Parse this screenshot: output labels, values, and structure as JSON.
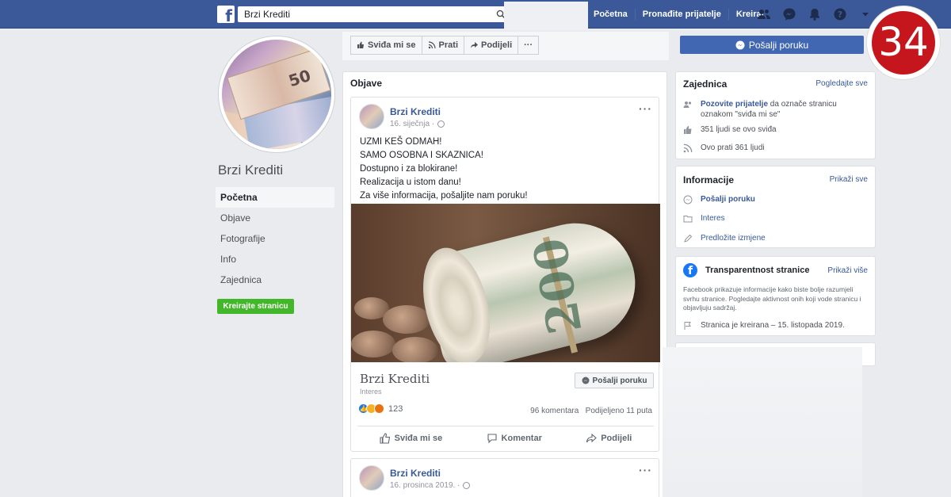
{
  "topbar": {
    "search_value": "Brzi Krediti",
    "nav": [
      "Početna",
      "Pronađite prijatelje",
      "Kreiraj"
    ]
  },
  "badge": "34",
  "page": {
    "name": "Brzi Krediti",
    "left_nav": [
      {
        "label": "Početna",
        "active": true
      },
      {
        "label": "Objave",
        "active": false
      },
      {
        "label": "Fotografije",
        "active": false
      },
      {
        "label": "Info",
        "active": false
      },
      {
        "label": "Zajednica",
        "active": false
      }
    ],
    "create_button": "Kreirajte stranicu"
  },
  "actions": {
    "like": "Sviđa mi se",
    "follow": "Prati",
    "share": "Podijeli",
    "more": "···",
    "send_message": "Pošalji poruku"
  },
  "feed": {
    "title": "Objave",
    "post1": {
      "author": "Brzi Krediti",
      "date": "16. siječnja ·",
      "menu": "···",
      "lines": [
        "UZMI KEŠ ODMAH!",
        "SAMO OSOBNA I SKAZNICA!",
        "Dostupno i za blokirane!",
        "Realizacija u istom danu!",
        "Za više informacija, pošaljite nam poruku!"
      ],
      "link_title": "Brzi Krediti",
      "link_sub": "Interes",
      "send_label": "Pošalji poruku",
      "reaction_count": "123",
      "comments": "96 komentara",
      "shares": "Podijeljeno 11 puta",
      "act_like": "Sviđa mi se",
      "act_comment": "Komentar",
      "act_share": "Podijeli"
    },
    "post2": {
      "author": "Brzi Krediti",
      "date": "16. prosinca 2019. ·",
      "menu": "···"
    }
  },
  "community": {
    "title": "Zajednica",
    "link": "Pogledajte sve",
    "invite_bold": "Pozovite prijatelje",
    "invite_rest": " da označe stranicu oznakom \"sviđa mi se\"",
    "likes": "351 ljudi se ovo sviđa",
    "follows": "Ovo prati 361 ljudi"
  },
  "info": {
    "title": "Informacije",
    "link": "Prikaži sve",
    "send": "Pošalji poruku",
    "category": "Interes",
    "suggest": "Predložite izmjene"
  },
  "transparency": {
    "title": "Transparentnost stranice",
    "link": "Prikaži više",
    "desc": "Facebook prikazuje informacije kako biste bolje razumjeli svrhu stranice. Pogledajte aktivnost onih koji vode stranicu i objavljuju sadržaj.",
    "created": "Stranica je kreirana – 15. listopada 2019."
  },
  "colors": {
    "brand": "#3b5998",
    "button_blue": "#4267b2",
    "create_green": "#42b72a",
    "badge_red": "#c4161c"
  }
}
